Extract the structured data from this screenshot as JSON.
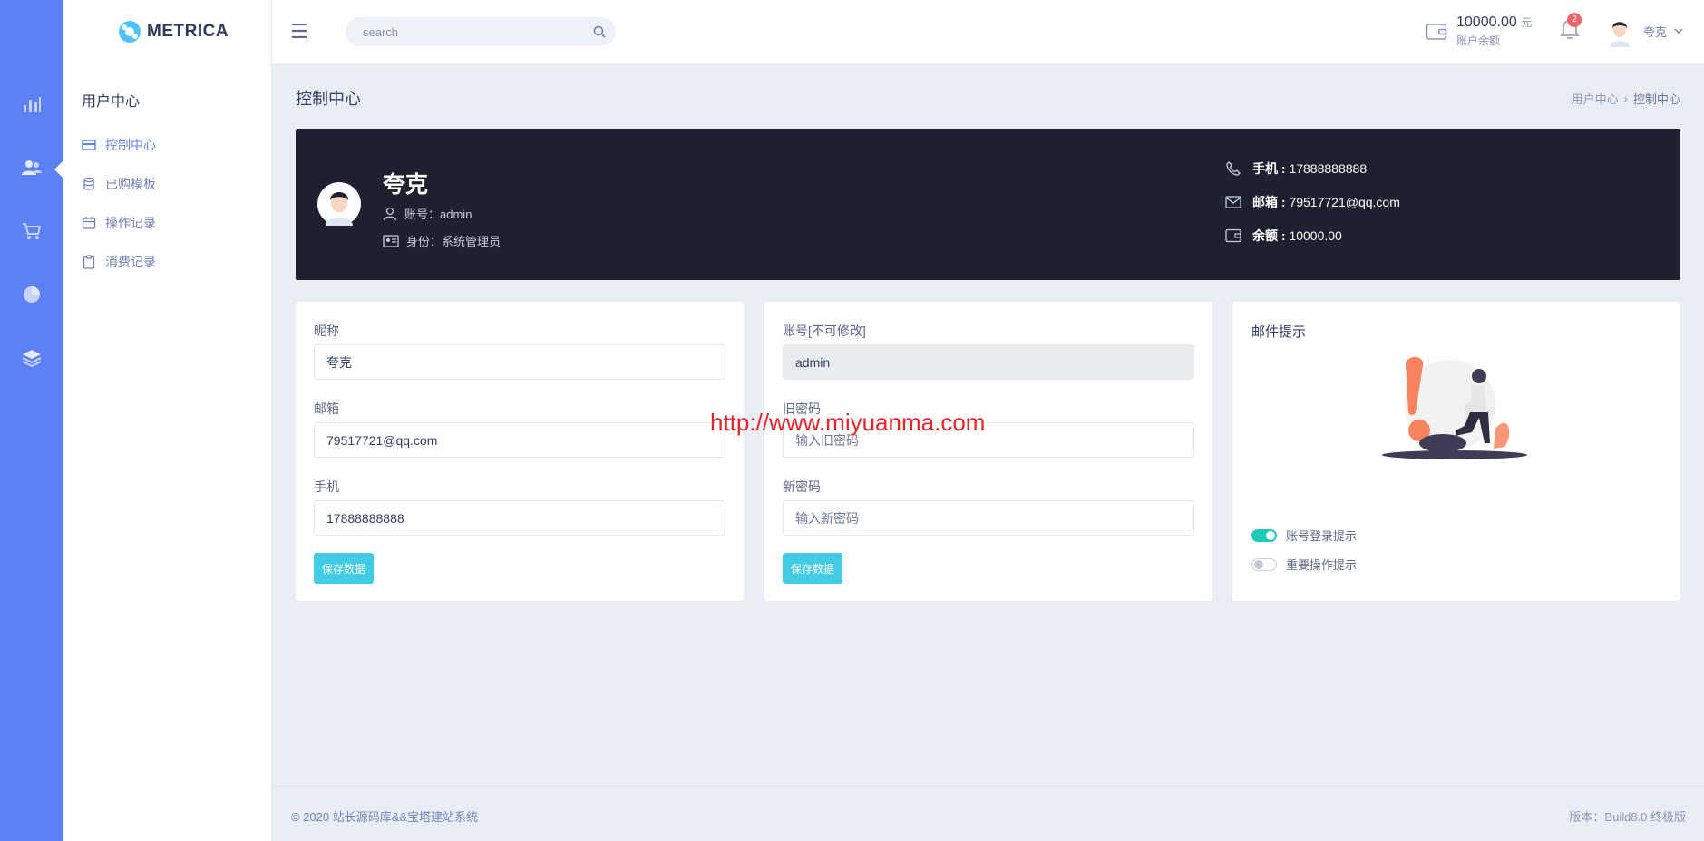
{
  "app": {
    "brand": "METRICA"
  },
  "rail": {
    "items": [
      "chart-icon",
      "users-icon",
      "cart-icon",
      "pie-icon",
      "layers-icon"
    ]
  },
  "sidebar": {
    "title": "用户中心",
    "items": [
      {
        "label": "控制中心",
        "icon": "card-icon",
        "active": true
      },
      {
        "label": "已购模板",
        "icon": "database-icon",
        "active": false
      },
      {
        "label": "操作记录",
        "icon": "calendar-icon",
        "active": false
      },
      {
        "label": "消费记录",
        "icon": "clipboard-icon",
        "active": false
      }
    ]
  },
  "topbar": {
    "search_placeholder": "search",
    "balance_amount": "10000.00",
    "balance_unit": "元",
    "balance_label": "账户余额",
    "notification_count": "2",
    "user_name": "夸克"
  },
  "page": {
    "title": "控制中心",
    "breadcrumb": [
      "用户中心",
      "控制中心"
    ]
  },
  "profile": {
    "name": "夸克",
    "account_label": "账号：",
    "account": "admin",
    "role_label": "身份：",
    "role": "系统管理员",
    "phone_label": "手机 :",
    "phone": "17888888888",
    "email_label": "邮箱 :",
    "email": "79517721@qq.com",
    "balance_label": "余额 :",
    "balance": "10000.00"
  },
  "form_profile": {
    "nickname_label": "昵称",
    "nickname": "夸克",
    "email_label": "邮箱",
    "email": "79517721@qq.com",
    "phone_label": "手机",
    "phone": "17888888888",
    "save_label": "保存数据"
  },
  "form_password": {
    "account_label": "账号[不可修改]",
    "account": "admin",
    "old_label": "旧密码",
    "old_placeholder": "输入旧密码",
    "new_label": "新密码",
    "new_placeholder": "输入新密码",
    "save_label": "保存数据"
  },
  "mail_tips": {
    "title": "邮件提示",
    "toggles": [
      {
        "label": "账号登录提示",
        "on": true
      },
      {
        "label": "重要操作提示",
        "on": false
      }
    ]
  },
  "watermark": "http://www.miyuanma.com",
  "footer": {
    "copyright": "© 2020 站长源码库&&宝塔建站系统",
    "version": "版本：Build8.0 终极版"
  },
  "colors": {
    "rail": "#5d80f5",
    "hero": "#1e1f2f",
    "button": "#41cbe4",
    "toggle_on": "#1ecab8"
  }
}
